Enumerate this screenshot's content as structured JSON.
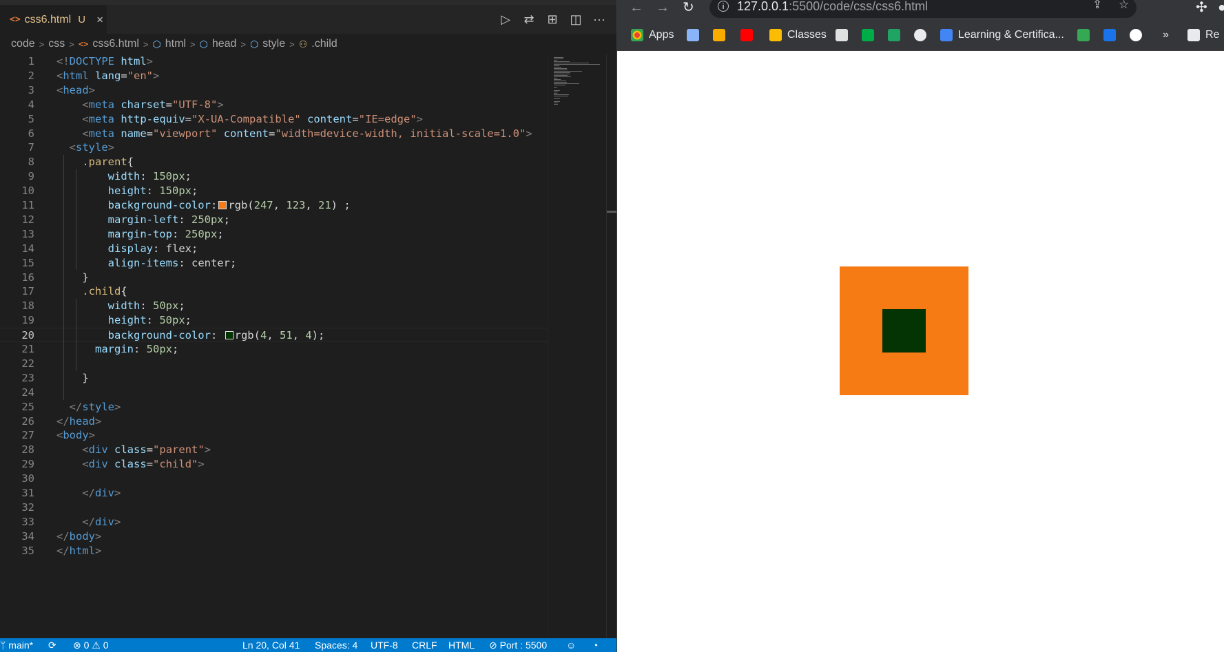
{
  "editor": {
    "tab": {
      "icon": "html-file-icon",
      "filename": "css6.html",
      "state": "U",
      "close": "×"
    },
    "actions": [
      {
        "name": "run-button",
        "icon": "▷"
      },
      {
        "name": "compare-changes-button",
        "icon": "⇄"
      },
      {
        "name": "open-preview-button",
        "icon": "⊞"
      },
      {
        "name": "split-editor-button",
        "icon": "◫"
      },
      {
        "name": "more-actions-button",
        "icon": "···"
      }
    ],
    "breadcrumb": [
      "code",
      "css",
      "css6.html",
      "html",
      "head",
      "style",
      ".child"
    ],
    "current_line": 20,
    "lines": [
      {
        "n": "1",
        "segs": [
          [
            "t-punc",
            "<!"
          ],
          [
            "t-tag",
            "DOCTYPE"
          ],
          [
            "t-plain",
            " "
          ],
          [
            "t-attr",
            "html"
          ],
          [
            "t-punc",
            ">"
          ]
        ]
      },
      {
        "n": "2",
        "segs": [
          [
            "t-punc",
            "<"
          ],
          [
            "t-tag",
            "html"
          ],
          [
            "t-plain",
            " "
          ],
          [
            "t-attr",
            "lang"
          ],
          [
            "t-plain",
            "="
          ],
          [
            "t-str",
            "\"en\""
          ],
          [
            "t-punc",
            ">"
          ]
        ]
      },
      {
        "n": "3",
        "segs": [
          [
            "t-punc",
            "<"
          ],
          [
            "t-tag",
            "head"
          ],
          [
            "t-punc",
            ">"
          ]
        ]
      },
      {
        "n": "4",
        "segs": [
          [
            "t-plain",
            "    "
          ],
          [
            "t-punc",
            "<"
          ],
          [
            "t-tag",
            "meta"
          ],
          [
            "t-plain",
            " "
          ],
          [
            "t-attr",
            "charset"
          ],
          [
            "t-plain",
            "="
          ],
          [
            "t-str",
            "\"UTF-8\""
          ],
          [
            "t-punc",
            ">"
          ]
        ]
      },
      {
        "n": "5",
        "segs": [
          [
            "t-plain",
            "    "
          ],
          [
            "t-punc",
            "<"
          ],
          [
            "t-tag",
            "meta"
          ],
          [
            "t-plain",
            " "
          ],
          [
            "t-attr",
            "http-equiv"
          ],
          [
            "t-plain",
            "="
          ],
          [
            "t-str",
            "\"X-UA-Compatible\""
          ],
          [
            "t-plain",
            " "
          ],
          [
            "t-attr",
            "content"
          ],
          [
            "t-plain",
            "="
          ],
          [
            "t-str",
            "\"IE=edge\""
          ],
          [
            "t-punc",
            ">"
          ]
        ]
      },
      {
        "n": "6",
        "segs": [
          [
            "t-plain",
            "    "
          ],
          [
            "t-punc",
            "<"
          ],
          [
            "t-tag",
            "meta"
          ],
          [
            "t-plain",
            " "
          ],
          [
            "t-attr",
            "name"
          ],
          [
            "t-plain",
            "="
          ],
          [
            "t-str",
            "\"viewport\""
          ],
          [
            "t-plain",
            " "
          ],
          [
            "t-attr",
            "content"
          ],
          [
            "t-plain",
            "="
          ],
          [
            "t-str",
            "\"width=device-width, initial-scale=1.0\""
          ],
          [
            "t-punc",
            ">"
          ]
        ]
      },
      {
        "n": "7",
        "segs": [
          [
            "t-plain",
            "  "
          ],
          [
            "t-punc",
            "<"
          ],
          [
            "t-tag",
            "style"
          ],
          [
            "t-punc",
            ">"
          ]
        ]
      },
      {
        "n": "8",
        "segs": [
          [
            "t-plain",
            "    "
          ],
          [
            "t-sel",
            ".parent"
          ],
          [
            "t-plain",
            "{"
          ]
        ]
      },
      {
        "n": "9",
        "segs": [
          [
            "t-plain",
            "        "
          ],
          [
            "t-prop",
            "width"
          ],
          [
            "t-plain",
            ": "
          ],
          [
            "t-num",
            "150px"
          ],
          [
            "t-plain",
            ";"
          ]
        ]
      },
      {
        "n": "10",
        "segs": [
          [
            "t-plain",
            "        "
          ],
          [
            "t-prop",
            "height"
          ],
          [
            "t-plain",
            ": "
          ],
          [
            "t-num",
            "150px"
          ],
          [
            "t-plain",
            ";"
          ]
        ]
      },
      {
        "n": "11",
        "segs": [
          [
            "t-plain",
            "        "
          ],
          [
            "t-prop",
            "background-color"
          ],
          [
            "t-plain",
            ":"
          ],
          [
            "swatch",
            "#f77b15"
          ],
          [
            "t-plain",
            "rgb("
          ],
          [
            "t-num",
            "247"
          ],
          [
            "t-plain",
            ", "
          ],
          [
            "t-num",
            "123"
          ],
          [
            "t-plain",
            ", "
          ],
          [
            "t-num",
            "21"
          ],
          [
            "t-plain",
            ") ;"
          ]
        ]
      },
      {
        "n": "12",
        "segs": [
          [
            "t-plain",
            "        "
          ],
          [
            "t-prop",
            "margin-left"
          ],
          [
            "t-plain",
            ": "
          ],
          [
            "t-num",
            "250px"
          ],
          [
            "t-plain",
            ";"
          ]
        ]
      },
      {
        "n": "13",
        "segs": [
          [
            "t-plain",
            "        "
          ],
          [
            "t-prop",
            "margin-top"
          ],
          [
            "t-plain",
            ": "
          ],
          [
            "t-num",
            "250px"
          ],
          [
            "t-plain",
            ";"
          ]
        ]
      },
      {
        "n": "14",
        "segs": [
          [
            "t-plain",
            "        "
          ],
          [
            "t-prop",
            "display"
          ],
          [
            "t-plain",
            ": "
          ],
          [
            "t-plain",
            "flex"
          ],
          [
            "t-plain",
            ";"
          ]
        ]
      },
      {
        "n": "15",
        "segs": [
          [
            "t-plain",
            "        "
          ],
          [
            "t-prop",
            "align-items"
          ],
          [
            "t-plain",
            ": "
          ],
          [
            "t-plain",
            "center"
          ],
          [
            "t-plain",
            ";"
          ]
        ]
      },
      {
        "n": "16",
        "segs": [
          [
            "t-plain",
            "    }"
          ]
        ]
      },
      {
        "n": "17",
        "segs": [
          [
            "t-plain",
            "    "
          ],
          [
            "t-sel",
            ".child"
          ],
          [
            "t-plain",
            "{"
          ]
        ]
      },
      {
        "n": "18",
        "segs": [
          [
            "t-plain",
            "        "
          ],
          [
            "t-prop",
            "width"
          ],
          [
            "t-plain",
            ": "
          ],
          [
            "t-num",
            "50px"
          ],
          [
            "t-plain",
            ";"
          ]
        ]
      },
      {
        "n": "19",
        "segs": [
          [
            "t-plain",
            "        "
          ],
          [
            "t-prop",
            "height"
          ],
          [
            "t-plain",
            ": "
          ],
          [
            "t-num",
            "50px"
          ],
          [
            "t-plain",
            ";"
          ]
        ]
      },
      {
        "n": "20",
        "segs": [
          [
            "t-plain",
            "        "
          ],
          [
            "t-prop",
            "background-color"
          ],
          [
            "t-plain",
            ": "
          ],
          [
            "swatch",
            "#043304"
          ],
          [
            "t-plain",
            "rgb("
          ],
          [
            "t-num",
            "4"
          ],
          [
            "t-plain",
            ", "
          ],
          [
            "t-num",
            "51"
          ],
          [
            "t-plain",
            ", "
          ],
          [
            "t-num",
            "4"
          ],
          [
            "t-plain",
            ");"
          ]
        ]
      },
      {
        "n": "21",
        "segs": [
          [
            "t-plain",
            "      "
          ],
          [
            "t-prop",
            "margin"
          ],
          [
            "t-plain",
            ": "
          ],
          [
            "t-num",
            "50px"
          ],
          [
            "t-plain",
            ";"
          ]
        ]
      },
      {
        "n": "22",
        "segs": []
      },
      {
        "n": "23",
        "segs": [
          [
            "t-plain",
            "    }"
          ]
        ]
      },
      {
        "n": "24",
        "segs": []
      },
      {
        "n": "25",
        "segs": [
          [
            "t-plain",
            "  "
          ],
          [
            "t-punc",
            "</"
          ],
          [
            "t-tag",
            "style"
          ],
          [
            "t-punc",
            ">"
          ]
        ]
      },
      {
        "n": "26",
        "segs": [
          [
            "t-punc",
            "</"
          ],
          [
            "t-tag",
            "head"
          ],
          [
            "t-punc",
            ">"
          ]
        ]
      },
      {
        "n": "27",
        "segs": [
          [
            "t-punc",
            "<"
          ],
          [
            "t-tag",
            "body"
          ],
          [
            "t-punc",
            ">"
          ]
        ]
      },
      {
        "n": "28",
        "segs": [
          [
            "t-plain",
            "    "
          ],
          [
            "t-punc",
            "<"
          ],
          [
            "t-tag",
            "div"
          ],
          [
            "t-plain",
            " "
          ],
          [
            "t-attr",
            "class"
          ],
          [
            "t-plain",
            "="
          ],
          [
            "t-str",
            "\"parent\""
          ],
          [
            "t-punc",
            ">"
          ]
        ]
      },
      {
        "n": "29",
        "segs": [
          [
            "t-plain",
            "    "
          ],
          [
            "t-punc",
            "<"
          ],
          [
            "t-tag",
            "div"
          ],
          [
            "t-plain",
            " "
          ],
          [
            "t-attr",
            "class"
          ],
          [
            "t-plain",
            "="
          ],
          [
            "t-str",
            "\"child\""
          ],
          [
            "t-punc",
            ">"
          ]
        ]
      },
      {
        "n": "30",
        "segs": []
      },
      {
        "n": "31",
        "segs": [
          [
            "t-plain",
            "    "
          ],
          [
            "t-punc",
            "</"
          ],
          [
            "t-tag",
            "div"
          ],
          [
            "t-punc",
            ">"
          ]
        ]
      },
      {
        "n": "32",
        "segs": []
      },
      {
        "n": "33",
        "segs": [
          [
            "t-plain",
            "    "
          ],
          [
            "t-punc",
            "</"
          ],
          [
            "t-tag",
            "div"
          ],
          [
            "t-punc",
            ">"
          ]
        ]
      },
      {
        "n": "34",
        "segs": [
          [
            "t-punc",
            "</"
          ],
          [
            "t-tag",
            "body"
          ],
          [
            "t-punc",
            ">"
          ]
        ]
      },
      {
        "n": "35",
        "segs": [
          [
            "t-punc",
            "</"
          ],
          [
            "t-tag",
            "html"
          ],
          [
            "t-punc",
            ">"
          ]
        ]
      }
    ]
  },
  "statusbar": {
    "branch": "main*",
    "sync": "⟳",
    "problems": "⊗ 0 ⚠ 0",
    "position": "Ln 20, Col 41",
    "spaces": "Spaces: 4",
    "encoding": "UTF-8",
    "eol": "CRLF",
    "language": "HTML",
    "port": "⊘ Port : 5500",
    "feedback": "☺",
    "bell": "🔔"
  },
  "browser": {
    "url_host": "127.0.0.1",
    "url_path": ":5500/code/css/css6.html",
    "bookmarks": [
      {
        "label": "Apps",
        "icon": "apps-grid-icon",
        "color": "#ea4335"
      },
      {
        "label": "",
        "icon": "team-icon",
        "color": "#8ab4f8"
      },
      {
        "label": "",
        "icon": "e-learning-icon",
        "color": "#f9ab00"
      },
      {
        "label": "",
        "icon": "youtube-icon",
        "color": "#ff0000"
      },
      {
        "label": "Classes",
        "icon": "classroom-icon",
        "color": "#fbbc04"
      },
      {
        "label": "",
        "icon": "map-icon",
        "color": "#e0e0e0"
      },
      {
        "label": "",
        "icon": "meet-icon",
        "color": "#00ac47"
      },
      {
        "label": "",
        "icon": "drive-icon",
        "color": "#1fa463"
      },
      {
        "label": "",
        "icon": "globe-icon",
        "color": "#e8eaed"
      },
      {
        "label": "Learning & Certifica...",
        "icon": "google-cloud-icon",
        "color": "#4285f4"
      },
      {
        "label": "",
        "icon": "refresh-green-icon",
        "color": "#34a853"
      },
      {
        "label": "",
        "icon": "azure-icon",
        "color": "#1a73e8"
      },
      {
        "label": "",
        "icon": "google-icon",
        "color": "#ffffff"
      },
      {
        "label": "»",
        "icon": "",
        "color": ""
      },
      {
        "label": "Re",
        "icon": "reading-list-icon",
        "color": "#e8eaed"
      }
    ],
    "parent_color": "#f77b15",
    "child_color": "#043304"
  }
}
